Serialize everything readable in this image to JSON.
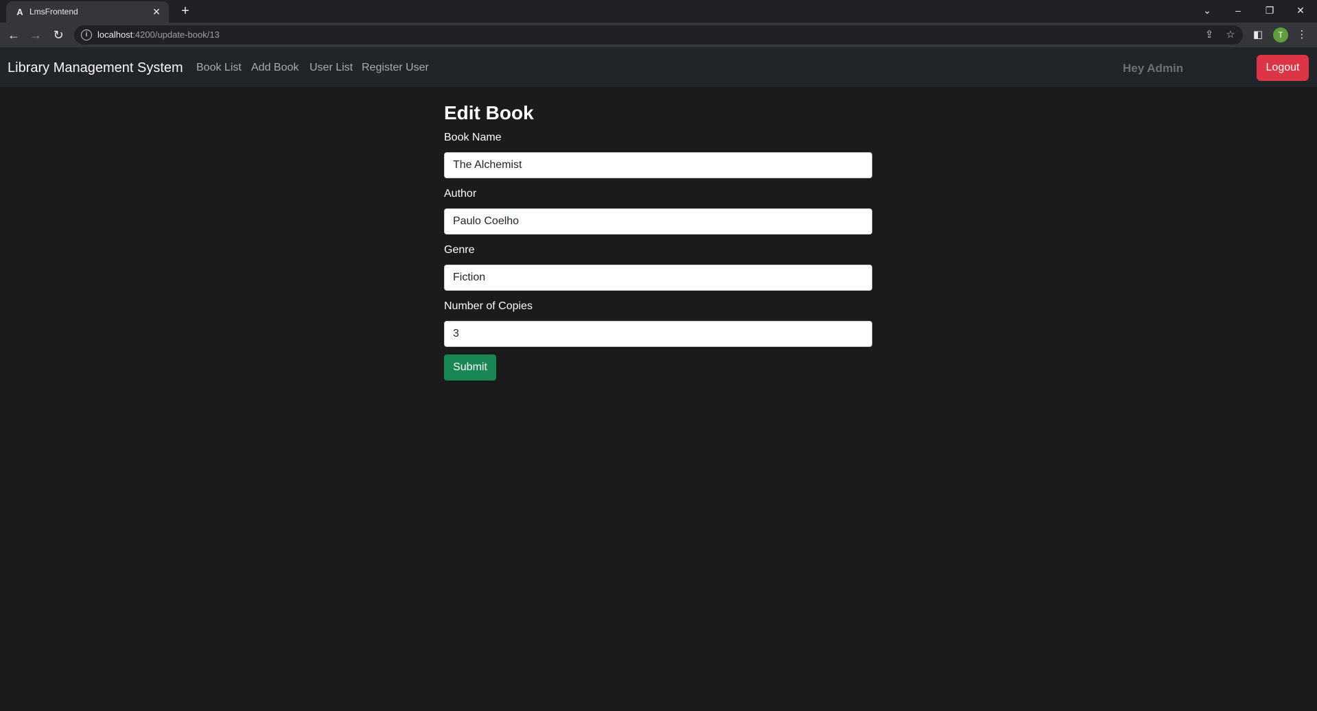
{
  "browser": {
    "tab_title": "LmsFrontend",
    "tab_favicon": "A",
    "url_host": "localhost",
    "url_rest": ":4200/update-book/13",
    "profile_initial": "T"
  },
  "navbar": {
    "brand": "Library Management System",
    "links": [
      "Book List",
      "Add Book",
      "User List",
      "Register User"
    ],
    "greeting": "Hey Admin",
    "logout_label": "Logout"
  },
  "form": {
    "title": "Edit Book",
    "fields": [
      {
        "label": "Book Name",
        "value": "The Alchemist"
      },
      {
        "label": "Author",
        "value": "Paulo Coelho"
      },
      {
        "label": "Genre",
        "value": "Fiction"
      },
      {
        "label": "Number of Copies",
        "value": "3"
      }
    ],
    "submit_label": "Submit"
  },
  "colors": {
    "page_bg": "#1b1b1c",
    "navbar_bg": "#212529",
    "logout": "#dc3545",
    "submit": "#198754"
  }
}
